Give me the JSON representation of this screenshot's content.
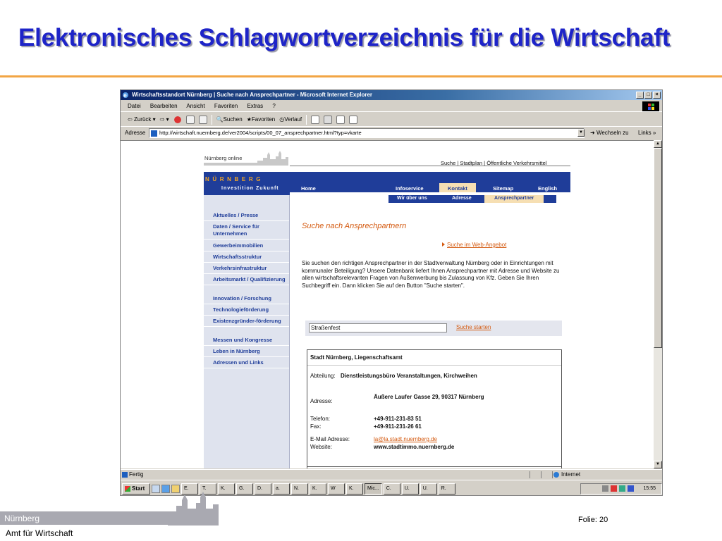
{
  "slide": {
    "title": "Elektronisches Schlagwortverzeichnis für die Wirtschaft",
    "footer_brand": "Nürnberg",
    "footer_department": "Amt für Wirtschaft",
    "page_number": "Folie: 20",
    "accent_color": "#f2a544",
    "title_color": "#1e24c8"
  },
  "browser": {
    "window_title": "Wirtschaftsstandort Nürnberg | Suche nach Ansprechpartner - Microsoft Internet Explorer",
    "window_buttons": [
      "_",
      "□",
      "×"
    ],
    "menu": [
      "Datei",
      "Bearbeiten",
      "Ansicht",
      "Favoriten",
      "Extras",
      "?"
    ],
    "toolbar": {
      "back": "Zurück",
      "search": "Suchen",
      "favorites": "Favoriten",
      "history": "Verlauf"
    },
    "address_label": "Adresse",
    "address_url": "http://wirtschaft.nuernberg.de/ver2004/scripts/00_07_ansprechpartner.html?typ=vkarte",
    "go_label": "Wechseln zu",
    "links_label": "Links »",
    "status_left": "Fertig",
    "status_zone": "Internet"
  },
  "taskbar": {
    "start_label": "Start",
    "tasks": [
      "E.",
      "T.",
      "K.",
      "G.",
      "D.",
      "a.",
      "N.",
      "K.",
      "W",
      "K.",
      "Mic...",
      "C.",
      "U.",
      "U.",
      "R."
    ],
    "active_task_index": 10,
    "clock": "15:55"
  },
  "site": {
    "online_label": "Nürnberg online",
    "top_links": "Suche | Stadtplan | Öffentliche Verkehrsmittel",
    "brand_name": "NÜRNBERG",
    "brand_tagline": "Investition Zukunft",
    "nav": {
      "home": "Home",
      "infoservice": "Infoservice",
      "kontakt": "Kontakt",
      "sitemap": "Sitemap",
      "english": "English"
    },
    "subnav": {
      "wir": "Wir über uns",
      "adresse": "Adresse",
      "ansprechpartner": "Ansprechpartner"
    },
    "sidebar": [
      "Aktuelles / Presse",
      "Daten / Service für Unternehmen",
      "Gewerbeimmobilien",
      "Wirtschaftsstruktur",
      "Verkehrsinfrastruktur",
      "Arbeitsmarkt / Qualifizierung",
      "Innovation / Forschung",
      "Technologieförderung",
      "Existenzgründer-förderung",
      "Messen und Kongresse",
      "Leben in Nürnberg",
      "Adressen und Links"
    ],
    "heading": "Suche nach Ansprechpartnern",
    "web_search_link": "Suche im Web-Angebot",
    "intro": "Sie suchen den richtigen Ansprechpartner in der Stadtverwaltung Nürnberg oder in Einrichtungen mit kommunaler Beteiligung? Unsere Datenbank liefert Ihnen Ansprechpartner mit Adresse und Website zu allen wirtschaftsrelevanten Fragen von Außenwerbung bis Zulassung von Kfz. Geben Sie Ihren Suchbegriff ein. Dann klicken Sie auf den Button \"Suche starten\".",
    "search_value": "Straßenfest",
    "search_button": "Suche starten",
    "result": {
      "title": "Stadt Nürnberg, Liegenschaftsamt",
      "dept_label": "Abteilung:",
      "dept_value": "Dienstleistungsbüro Veranstaltungen, Kirchweihen",
      "address_label": "Adresse:",
      "address_value": "Äußere Laufer Gasse 29, 90317 Nürnberg",
      "phone_label": "Telefon:",
      "phone_value": "+49-911-231-83 51",
      "fax_label": "Fax:",
      "fax_value": "+49-911-231-26 61",
      "email_label": "E-Mail Adresse:",
      "email_value": "la@la.stadt.nuernberg.de",
      "web_label": "Website:",
      "web_value": "www.stadtimmo.nuernberg.de"
    }
  }
}
